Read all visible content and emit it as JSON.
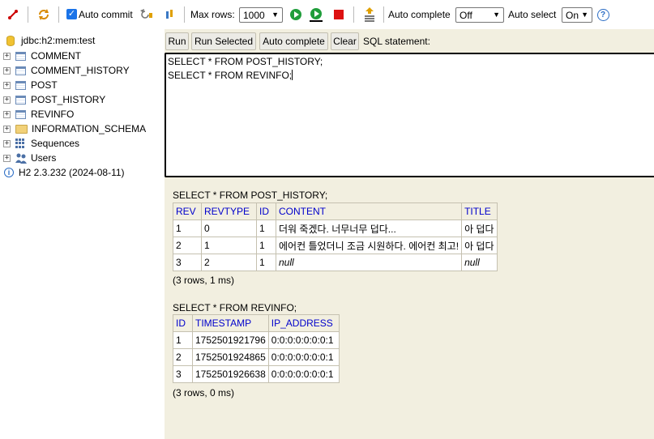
{
  "toolbar": {
    "auto_commit_label": "Auto commit",
    "auto_commit_checked": true,
    "max_rows_label": "Max rows:",
    "max_rows_value": "1000",
    "auto_complete_label": "Auto complete",
    "auto_complete_value": "Off",
    "auto_select_label": "Auto select",
    "auto_select_value": "On",
    "help_label": "?"
  },
  "tree": {
    "connection": "jdbc:h2:mem:test",
    "tables": [
      "COMMENT",
      "COMMENT_HISTORY",
      "POST",
      "POST_HISTORY",
      "REVINFO"
    ],
    "schema": "INFORMATION_SCHEMA",
    "sequences": "Sequences",
    "users": "Users",
    "version": "H2 2.3.232 (2024-08-11)"
  },
  "sql_panel": {
    "run_label": "Run",
    "run_selected_label": "Run Selected",
    "auto_complete_label": "Auto complete",
    "clear_label": "Clear",
    "statement_label": "SQL statement:",
    "editor_lines": [
      "SELECT * FROM POST_HISTORY;",
      "SELECT * FROM REVINFO;"
    ]
  },
  "results": [
    {
      "statement": "SELECT * FROM POST_HISTORY;",
      "columns": [
        "REV",
        "REVTYPE",
        "ID",
        "CONTENT",
        "TITLE"
      ],
      "rows": [
        [
          "1",
          "0",
          "1",
          "더워 죽겠다. 너무너무 덥다...",
          "아 덥다"
        ],
        [
          "2",
          "1",
          "1",
          "에어컨 틀었더니 조금 시원하다. 에어컨 최고!",
          "아 덥다"
        ],
        [
          "3",
          "2",
          "1",
          "null",
          "null"
        ]
      ],
      "row_info": "(3 rows, 1 ms)"
    },
    {
      "statement": "SELECT * FROM REVINFO;",
      "columns": [
        "ID",
        "TIMESTAMP",
        "IP_ADDRESS"
      ],
      "rows": [
        [
          "1",
          "1752501921796",
          "0:0:0:0:0:0:0:1"
        ],
        [
          "2",
          "1752501924865",
          "0:0:0:0:0:0:0:1"
        ],
        [
          "3",
          "1752501926638",
          "0:0:0:0:0:0:0:1"
        ]
      ],
      "row_info": "(3 rows, 0 ms)"
    }
  ]
}
